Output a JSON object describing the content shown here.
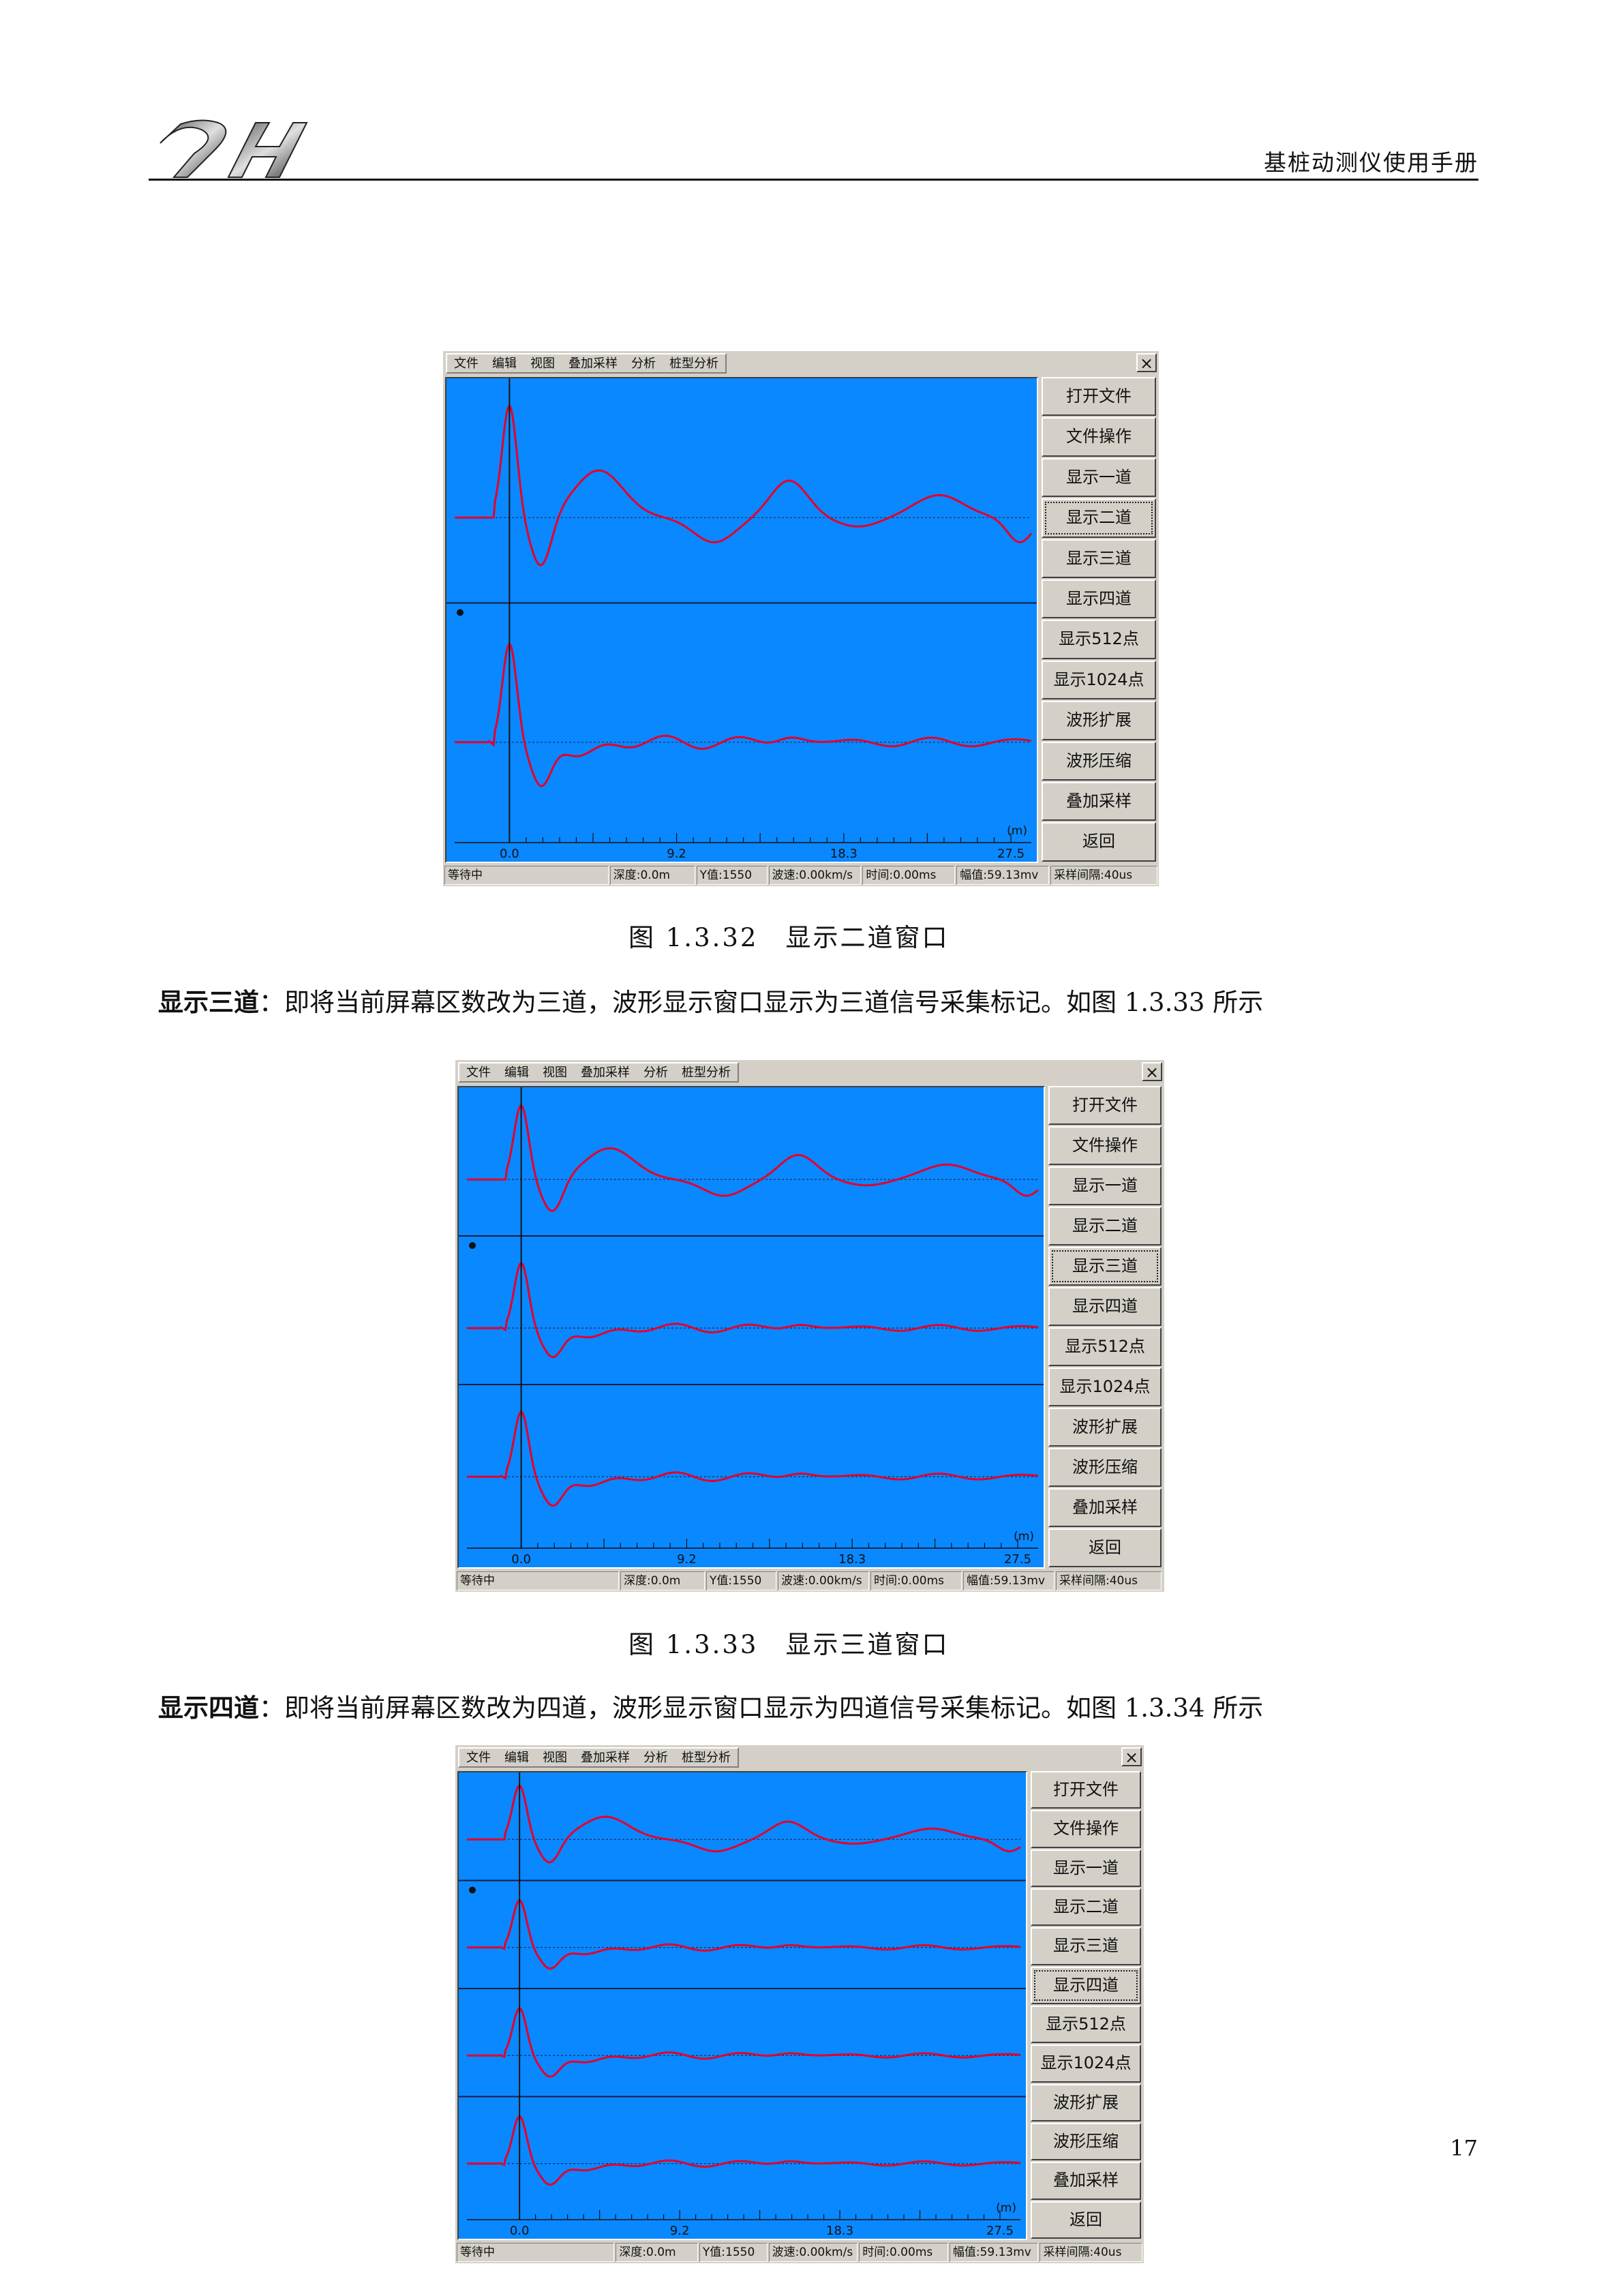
{
  "header": {
    "manual_title": "基桩动测仪使用手册"
  },
  "windows": [
    {
      "menus": [
        "文件",
        "编辑",
        "视图",
        "叠加采样",
        "分析",
        "桩型分析"
      ],
      "close_glyph": "×",
      "buttons": [
        "打开文件",
        "文件操作",
        "显示一道",
        "显示二道",
        "显示三道",
        "显示四道",
        "显示512点",
        "显示1024点",
        "波形扩展",
        "波形压缩",
        "叠加采样",
        "返回"
      ],
      "active_button": "显示二道",
      "channels": 2,
      "axis_ticks": [
        "0.0",
        "9.2",
        "18.3",
        "27.5"
      ],
      "axis_unit": "(m)",
      "status": [
        "等待中",
        "深度:0.0m",
        "Y值:1550",
        "波速:0.00km/s",
        "时间:0.00ms",
        "幅值:59.13mv",
        "采样间隔:40us"
      ]
    },
    {
      "menus": [
        "文件",
        "编辑",
        "视图",
        "叠加采样",
        "分析",
        "桩型分析"
      ],
      "close_glyph": "×",
      "buttons": [
        "打开文件",
        "文件操作",
        "显示一道",
        "显示二道",
        "显示三道",
        "显示四道",
        "显示512点",
        "显示1024点",
        "波形扩展",
        "波形压缩",
        "叠加采样",
        "返回"
      ],
      "active_button": "显示三道",
      "channels": 3,
      "axis_ticks": [
        "0.0",
        "9.2",
        "18.3",
        "27.5"
      ],
      "axis_unit": "(m)",
      "status": [
        "等待中",
        "深度:0.0m",
        "Y值:1550",
        "波速:0.00km/s",
        "时间:0.00ms",
        "幅值:59.13mv",
        "采样间隔:40us"
      ]
    },
    {
      "menus": [
        "文件",
        "编辑",
        "视图",
        "叠加采样",
        "分析",
        "桩型分析"
      ],
      "close_glyph": "×",
      "buttons": [
        "打开文件",
        "文件操作",
        "显示一道",
        "显示二道",
        "显示三道",
        "显示四道",
        "显示512点",
        "显示1024点",
        "波形扩展",
        "波形压缩",
        "叠加采样",
        "返回"
      ],
      "active_button": "显示四道",
      "channels": 4,
      "axis_ticks": [
        "0.0",
        "9.2",
        "18.3",
        "27.5"
      ],
      "axis_unit": "(m)",
      "status": [
        "等待中",
        "深度:0.0m",
        "Y值:1550",
        "波速:0.00km/s",
        "时间:0.00ms",
        "幅值:59.13mv",
        "采样间隔:40us"
      ]
    }
  ],
  "captions": {
    "fig_1_3_32": "图 1.3.32　显示二道窗口",
    "fig_1_3_33": "图 1.3.33　显示三道窗口"
  },
  "paragraphs": {
    "three_label": "显示三道",
    "three_text": "：即将当前屏幕区数改为三道，波形显示窗口显示为三道信号采集标记。如图 1.3.33 所示",
    "four_label": "显示四道",
    "four_text": "：即将当前屏幕区数改为四道，波形显示窗口显示为四道信号采集标记。如图 1.3.34 所示"
  },
  "page_number": "17",
  "colors": {
    "plot_bg": "#0a88ff",
    "trace": "#e4002b",
    "window": "#d4d0c8"
  }
}
